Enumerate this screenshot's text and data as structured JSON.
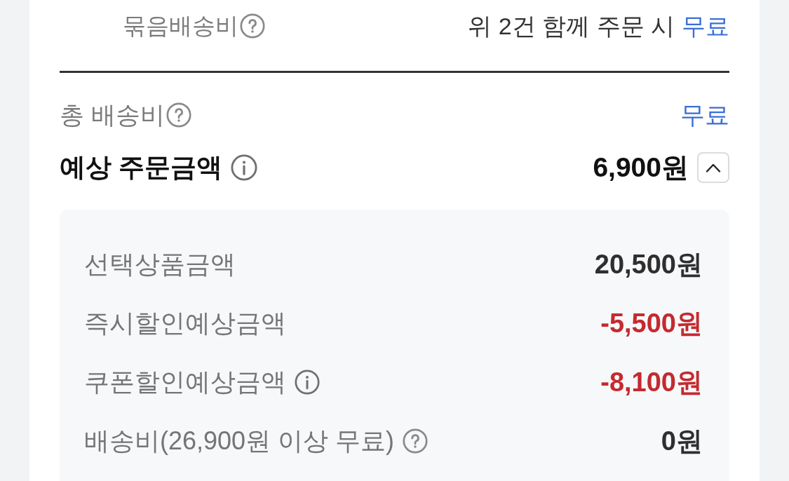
{
  "bundle_shipping": {
    "label": "묶음배송비",
    "text": "위 2건 함께 주문 시",
    "value": "무료"
  },
  "total_shipping": {
    "label": "총 배송비",
    "value": "무료"
  },
  "estimated_total": {
    "label": "예상 주문금액",
    "value": "6,900원",
    "expanded": true
  },
  "breakdown": [
    {
      "label": "선택상품금액",
      "value": "20,500원",
      "kind": "subtotal"
    },
    {
      "label": "즉시할인예상금액",
      "value": "-5,500원",
      "kind": "discount"
    },
    {
      "label": "쿠폰할인예상금액",
      "value": "-8,100원",
      "kind": "coupon"
    },
    {
      "label": "배송비(26,900원 이상 무료)",
      "value": "0원",
      "kind": "shipping"
    }
  ]
}
